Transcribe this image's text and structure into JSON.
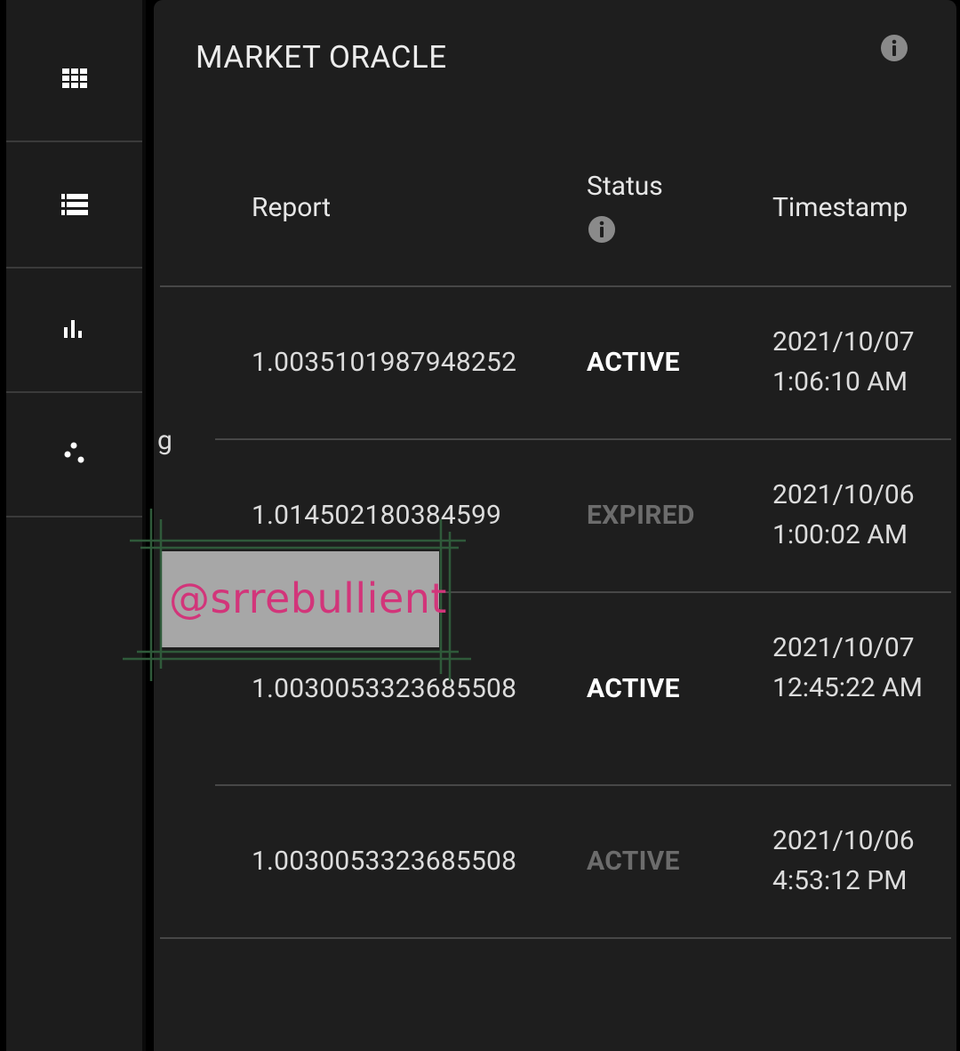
{
  "app": {
    "title": "MARKET ORACLE"
  },
  "nav": {
    "items": [
      {
        "icon": "grid-icon"
      },
      {
        "icon": "list-icon"
      },
      {
        "icon": "bar-chart-icon"
      },
      {
        "icon": "scatter-dots-icon"
      }
    ]
  },
  "table": {
    "columns": {
      "report": "Report",
      "status": "Status",
      "timestamp": "Timestamp"
    },
    "rows": [
      {
        "report": "1.0035101987948252",
        "status": "ACTIVE",
        "date": "2021/10/07",
        "time": "1:06:10 AM"
      },
      {
        "report": "1.014502180384599",
        "status": "EXPIRED",
        "date": "2021/10/06",
        "time": "1:00:02 AM"
      },
      {
        "report": "1.0030053323685508",
        "status": "ACTIVE",
        "date": "2021/10/07",
        "time": "12:45:22 AM"
      },
      {
        "report": "1.0030053323685508",
        "status": "ACTIVE",
        "date": "2021/10/06",
        "time": "4:53:12 PM"
      }
    ]
  },
  "partial_label": "g",
  "watermark": {
    "text": "@srrebullient"
  },
  "colors": {
    "background": "#000000",
    "card": "#1e1e1e",
    "rail": "#1c1c1c",
    "status_active": "#ffffff",
    "status_dim": "#6c6c6c",
    "watermark_text": "#d2357a",
    "watermark_box": "#a7a7a7",
    "watermark_frame": "#2f5a3a"
  }
}
